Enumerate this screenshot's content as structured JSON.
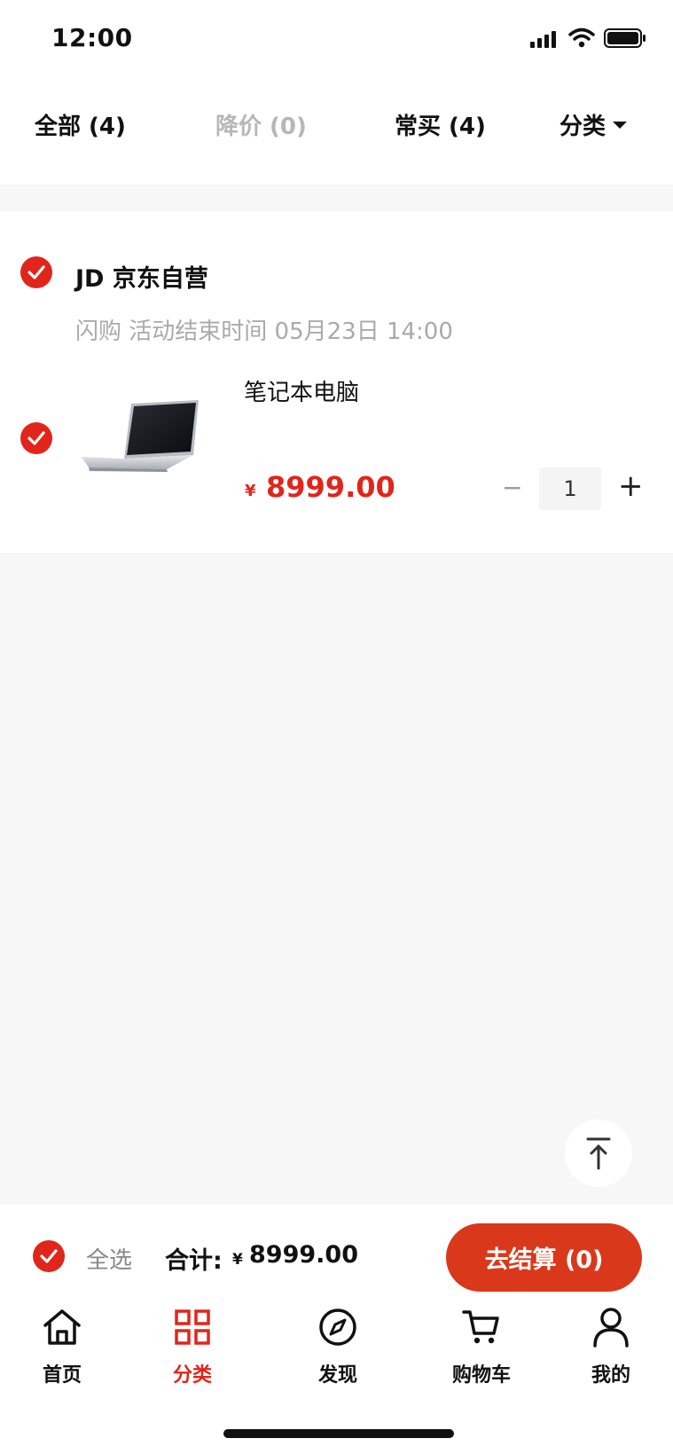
{
  "status_bar": {
    "time": "12:00"
  },
  "tabs": [
    {
      "label": "全部 (4)",
      "active": true
    },
    {
      "label": "降价 (0)",
      "active": false
    },
    {
      "label": "常买 (4)",
      "active": false
    },
    {
      "label": "分类",
      "active": false
    }
  ],
  "shop": {
    "name": "JD 京东自营",
    "promo": "闪购 活动结束时间 05月23日 14:00",
    "checked": true
  },
  "product": {
    "name": "笔记本电脑",
    "currency": "¥",
    "price": "8999.00",
    "quantity": "1",
    "checked": true,
    "image_icon": "laptop-image"
  },
  "bottom_bar": {
    "select_all_label": "全选",
    "total_label": "合计:",
    "currency": "¥",
    "total_value": "8999.00",
    "checkout_label": "去结算 (0)"
  },
  "nav": [
    {
      "label": "首页",
      "icon": "home-icon",
      "active": false
    },
    {
      "label": "分类",
      "icon": "category-icon",
      "active": true
    },
    {
      "label": "发现",
      "icon": "compass-icon",
      "active": false
    },
    {
      "label": "购物车",
      "icon": "cart-icon",
      "active": false
    },
    {
      "label": "我的",
      "icon": "user-icon",
      "active": false
    }
  ],
  "colors": {
    "accent": "#e1251b",
    "checkout": "#d9391a",
    "background_gray": "#f7f7f7"
  }
}
